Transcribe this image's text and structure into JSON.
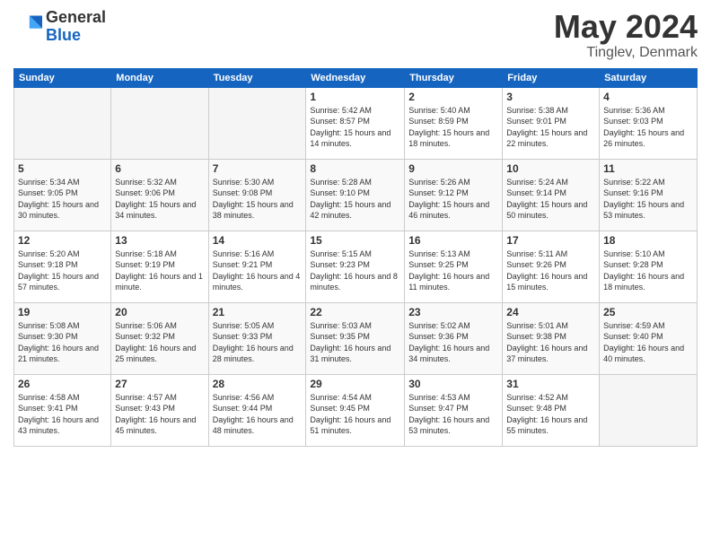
{
  "logo": {
    "general": "General",
    "blue": "Blue"
  },
  "title": "May 2024",
  "subtitle": "Tinglev, Denmark",
  "headers": [
    "Sunday",
    "Monday",
    "Tuesday",
    "Wednesday",
    "Thursday",
    "Friday",
    "Saturday"
  ],
  "weeks": [
    [
      {
        "day": "",
        "info": ""
      },
      {
        "day": "",
        "info": ""
      },
      {
        "day": "",
        "info": ""
      },
      {
        "day": "1",
        "info": "Sunrise: 5:42 AM\nSunset: 8:57 PM\nDaylight: 15 hours\nand 14 minutes."
      },
      {
        "day": "2",
        "info": "Sunrise: 5:40 AM\nSunset: 8:59 PM\nDaylight: 15 hours\nand 18 minutes."
      },
      {
        "day": "3",
        "info": "Sunrise: 5:38 AM\nSunset: 9:01 PM\nDaylight: 15 hours\nand 22 minutes."
      },
      {
        "day": "4",
        "info": "Sunrise: 5:36 AM\nSunset: 9:03 PM\nDaylight: 15 hours\nand 26 minutes."
      }
    ],
    [
      {
        "day": "5",
        "info": "Sunrise: 5:34 AM\nSunset: 9:05 PM\nDaylight: 15 hours\nand 30 minutes."
      },
      {
        "day": "6",
        "info": "Sunrise: 5:32 AM\nSunset: 9:06 PM\nDaylight: 15 hours\nand 34 minutes."
      },
      {
        "day": "7",
        "info": "Sunrise: 5:30 AM\nSunset: 9:08 PM\nDaylight: 15 hours\nand 38 minutes."
      },
      {
        "day": "8",
        "info": "Sunrise: 5:28 AM\nSunset: 9:10 PM\nDaylight: 15 hours\nand 42 minutes."
      },
      {
        "day": "9",
        "info": "Sunrise: 5:26 AM\nSunset: 9:12 PM\nDaylight: 15 hours\nand 46 minutes."
      },
      {
        "day": "10",
        "info": "Sunrise: 5:24 AM\nSunset: 9:14 PM\nDaylight: 15 hours\nand 50 minutes."
      },
      {
        "day": "11",
        "info": "Sunrise: 5:22 AM\nSunset: 9:16 PM\nDaylight: 15 hours\nand 53 minutes."
      }
    ],
    [
      {
        "day": "12",
        "info": "Sunrise: 5:20 AM\nSunset: 9:18 PM\nDaylight: 15 hours\nand 57 minutes."
      },
      {
        "day": "13",
        "info": "Sunrise: 5:18 AM\nSunset: 9:19 PM\nDaylight: 16 hours\nand 1 minute."
      },
      {
        "day": "14",
        "info": "Sunrise: 5:16 AM\nSunset: 9:21 PM\nDaylight: 16 hours\nand 4 minutes."
      },
      {
        "day": "15",
        "info": "Sunrise: 5:15 AM\nSunset: 9:23 PM\nDaylight: 16 hours\nand 8 minutes."
      },
      {
        "day": "16",
        "info": "Sunrise: 5:13 AM\nSunset: 9:25 PM\nDaylight: 16 hours\nand 11 minutes."
      },
      {
        "day": "17",
        "info": "Sunrise: 5:11 AM\nSunset: 9:26 PM\nDaylight: 16 hours\nand 15 minutes."
      },
      {
        "day": "18",
        "info": "Sunrise: 5:10 AM\nSunset: 9:28 PM\nDaylight: 16 hours\nand 18 minutes."
      }
    ],
    [
      {
        "day": "19",
        "info": "Sunrise: 5:08 AM\nSunset: 9:30 PM\nDaylight: 16 hours\nand 21 minutes."
      },
      {
        "day": "20",
        "info": "Sunrise: 5:06 AM\nSunset: 9:32 PM\nDaylight: 16 hours\nand 25 minutes."
      },
      {
        "day": "21",
        "info": "Sunrise: 5:05 AM\nSunset: 9:33 PM\nDaylight: 16 hours\nand 28 minutes."
      },
      {
        "day": "22",
        "info": "Sunrise: 5:03 AM\nSunset: 9:35 PM\nDaylight: 16 hours\nand 31 minutes."
      },
      {
        "day": "23",
        "info": "Sunrise: 5:02 AM\nSunset: 9:36 PM\nDaylight: 16 hours\nand 34 minutes."
      },
      {
        "day": "24",
        "info": "Sunrise: 5:01 AM\nSunset: 9:38 PM\nDaylight: 16 hours\nand 37 minutes."
      },
      {
        "day": "25",
        "info": "Sunrise: 4:59 AM\nSunset: 9:40 PM\nDaylight: 16 hours\nand 40 minutes."
      }
    ],
    [
      {
        "day": "26",
        "info": "Sunrise: 4:58 AM\nSunset: 9:41 PM\nDaylight: 16 hours\nand 43 minutes."
      },
      {
        "day": "27",
        "info": "Sunrise: 4:57 AM\nSunset: 9:43 PM\nDaylight: 16 hours\nand 45 minutes."
      },
      {
        "day": "28",
        "info": "Sunrise: 4:56 AM\nSunset: 9:44 PM\nDaylight: 16 hours\nand 48 minutes."
      },
      {
        "day": "29",
        "info": "Sunrise: 4:54 AM\nSunset: 9:45 PM\nDaylight: 16 hours\nand 51 minutes."
      },
      {
        "day": "30",
        "info": "Sunrise: 4:53 AM\nSunset: 9:47 PM\nDaylight: 16 hours\nand 53 minutes."
      },
      {
        "day": "31",
        "info": "Sunrise: 4:52 AM\nSunset: 9:48 PM\nDaylight: 16 hours\nand 55 minutes."
      },
      {
        "day": "",
        "info": ""
      }
    ]
  ]
}
